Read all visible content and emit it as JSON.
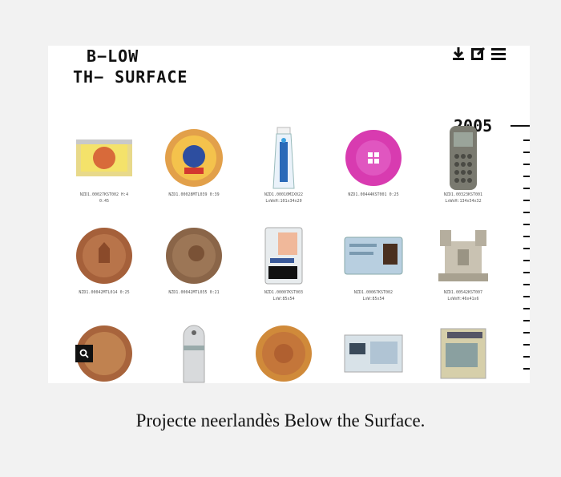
{
  "logo": {
    "line1": "B−LOW",
    "line2": "TH− SURFACE"
  },
  "toolbar": {
    "download_icon": "download-icon",
    "edit_icon": "edit-icon",
    "menu_icon": "menu-icon"
  },
  "timeline": {
    "year": "2005"
  },
  "items": [
    {
      "caption": "NZD1.00027KST002 H:4\n0:45",
      "icon": "wrapper-image"
    },
    {
      "caption": "NZD1.00028MTL039 0:39",
      "icon": "plate-image"
    },
    {
      "caption": "NZD1.00010MIX022\nLxWxH:101x34x20",
      "icon": "toothpaste-image"
    },
    {
      "caption": "NZD1.00444KST001 0:25",
      "icon": "pink-button-image"
    },
    {
      "caption": "NZD1.00323KST001\nLxWxH:134x54x32",
      "icon": "phone-image"
    },
    {
      "caption": "NZD1.00042MTL014 0:25",
      "icon": "coin-image"
    },
    {
      "caption": "NZD1.00042MTL035 0:21",
      "icon": "coin-image"
    },
    {
      "caption": "NZD1.00007KST003\nLxW:85x54",
      "icon": "id-card-image"
    },
    {
      "caption": "NZD1.00067KST002\nLxW:85x54",
      "icon": "id-card-image"
    },
    {
      "caption": "NZD1.00542KST007\nLxWxH:46x41x6",
      "icon": "connector-image"
    },
    {
      "caption": "",
      "icon": "coin-image"
    },
    {
      "caption": "",
      "icon": "capsule-image"
    },
    {
      "caption": "",
      "icon": "coin-image"
    },
    {
      "caption": "",
      "icon": "card-image"
    },
    {
      "caption": "",
      "icon": "card-image"
    }
  ],
  "search_icon": "search-icon",
  "figure_caption": "Projecte neerlandès Below the Surface."
}
